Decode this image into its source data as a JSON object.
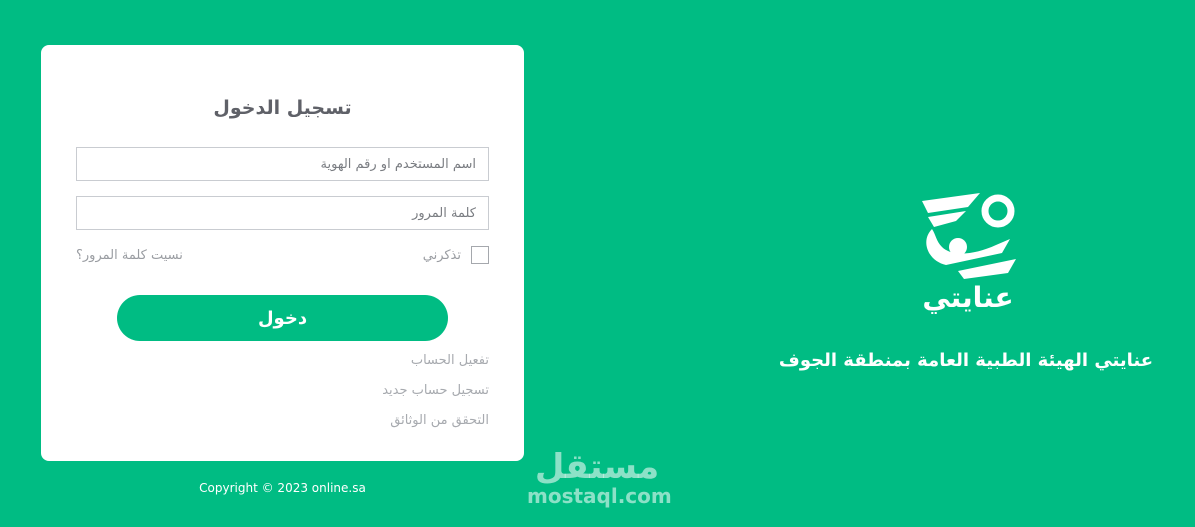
{
  "login": {
    "title": "تسجيل الدخول",
    "username_placeholder": "اسم المستخدم او رقم الهوية",
    "password_placeholder": "كلمة المرور",
    "remember_label": "تذكرني",
    "forgot_label": "نسيت كلمة المرور؟",
    "submit_label": "دخول",
    "links": [
      {
        "label": "تفعيل الحساب"
      },
      {
        "label": "تسجيل حساب جديد"
      },
      {
        "label": "التحقق من الوثائق"
      }
    ]
  },
  "footer": {
    "copyright": "Copyright © 2023 online.sa"
  },
  "brand": {
    "logo_text": "عنايتي",
    "tagline": "عنايتي الهيئة الطبية العامة بمنطقة الجوف"
  },
  "watermark": {
    "arabic": "مستقل",
    "latin": "mostaql.com"
  },
  "colors": {
    "brand_green": "#00bc83",
    "card_bg": "#ffffff",
    "muted_text": "#9a9da2"
  }
}
